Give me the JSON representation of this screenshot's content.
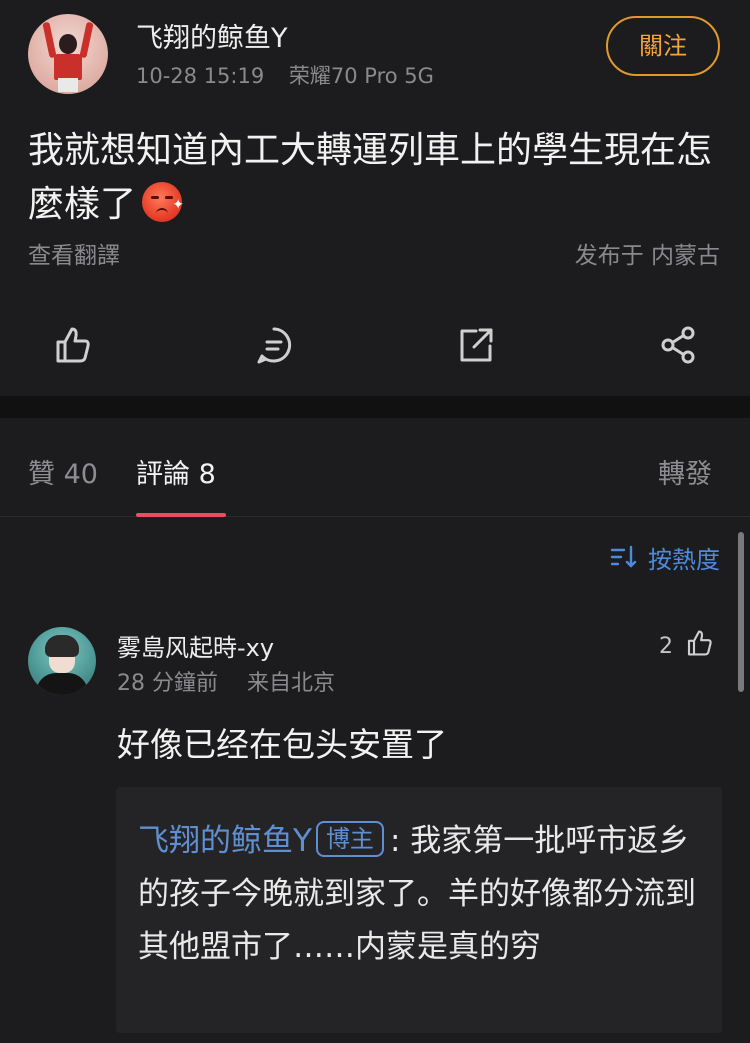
{
  "post": {
    "author": "飞翔的鲸鱼Y",
    "datetime": "10-28 15:19",
    "device": "荣耀70 Pro 5G",
    "follow_label": "關注",
    "text": "我就想知道內工大轉運列車上的學生現在怎麼樣了",
    "emoji": "angry-face-emoji",
    "translate_label": "查看翻譯",
    "location": "发布于 内蒙古",
    "actions": [
      "like-icon",
      "comment-icon",
      "repost-icon",
      "share-icon"
    ]
  },
  "tabs": {
    "likes": "贊 40",
    "comments": "評論 8",
    "reposts": "轉發",
    "active": "comments"
  },
  "sort_label": "按熱度",
  "comment": {
    "user": "雾島风起時-xy",
    "time": "28 分鐘前",
    "location": "来自北京",
    "likes": "2",
    "text": "好像已经在包头安置了",
    "quote": {
      "user": "飞翔的鲸鱼Y",
      "badge": "博主",
      "separator": ": ",
      "text": "我家第一批呼市返乡的孩子今晚就到家了。羊的好像都分流到其他盟市了……内蒙是真的穷"
    }
  },
  "colors": {
    "background": "#1c1c1e",
    "accent_orange": "#e09a2a",
    "tab_underline": "#ee4d5f",
    "link_blue": "#5f8fd1"
  }
}
